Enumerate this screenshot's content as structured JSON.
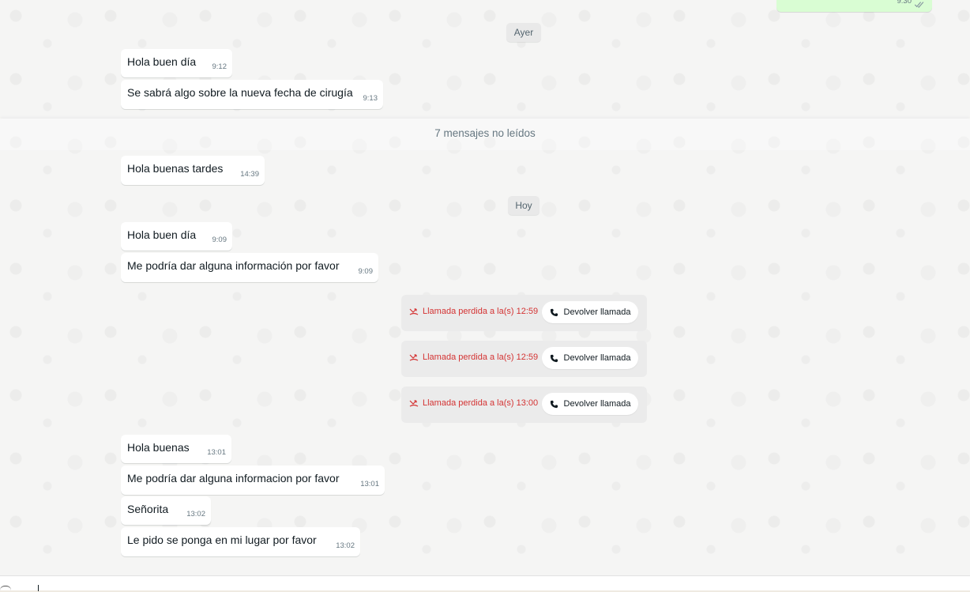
{
  "top_outgoing": {
    "time": "9:30"
  },
  "dividers": {
    "yesterday": "Ayer",
    "today": "Hoy",
    "unread": "7 mensajes no leídos"
  },
  "messages": [
    {
      "text": "Hola buen día",
      "time": "9:12"
    },
    {
      "text": "Se sabrá algo sobre la nueva fecha de cirugía",
      "time": "9:13"
    },
    {
      "text": "Hola buenas tardes",
      "time": "14:39"
    },
    {
      "text": "Hola buen día",
      "time": "9:09"
    },
    {
      "text": "Me podría dar alguna información por favor",
      "time": "9:09"
    },
    {
      "text": "Hola buenas",
      "time": "13:01"
    },
    {
      "text": "Me podría dar alguna informacion por favor",
      "time": "13:01"
    },
    {
      "text": "Señorita",
      "time": "13:02"
    },
    {
      "text": "Le pido se ponga en mi lugar por favor",
      "time": "13:02"
    }
  ],
  "calls": [
    {
      "label": "Llamada perdida a la(s) 12:59",
      "button": "Devolver llamada"
    },
    {
      "label": "Llamada perdida a la(s) 12:59",
      "button": "Devolver llamada"
    },
    {
      "label": "Llamada perdida a la(s) 13:00",
      "button": "Devolver llamada"
    }
  ],
  "colors": {
    "missed": "#d43333",
    "outgoing_bubble": "#d9fdd3",
    "incoming_bubble": "#ffffff"
  },
  "icons": {
    "missed_call": "missed-call-icon",
    "phone": "phone-icon",
    "read_receipt": "double-check-icon"
  }
}
